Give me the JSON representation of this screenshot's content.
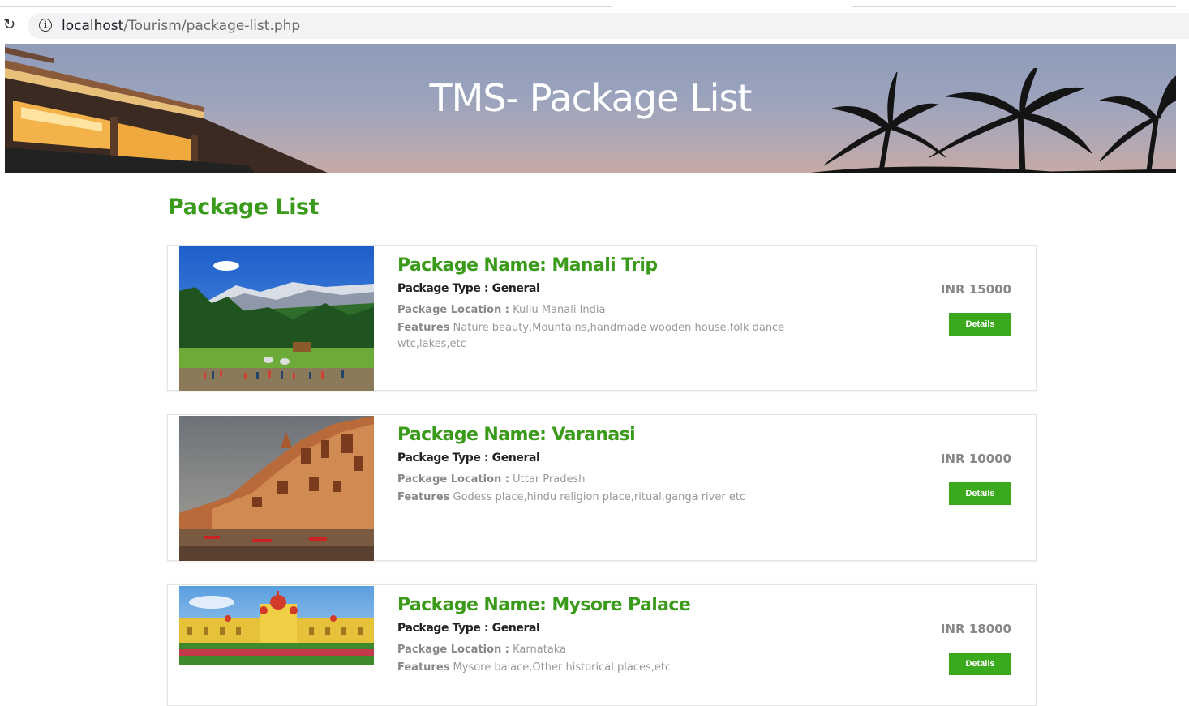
{
  "browser": {
    "url_host": "localhost",
    "url_path": "/Tourism/package-list.php"
  },
  "banner": {
    "title": "TMS- Package List"
  },
  "main": {
    "section_title": "Package List",
    "location_label": "Package Location :",
    "features_label": "Features",
    "details_label": "Details",
    "packages": [
      {
        "name": "Package Name: Manali Trip",
        "type": "Package Type : General",
        "location": "Kullu Manali India",
        "features": "Nature beauty,Mountains,handmade wooden house,folk dance wtc,lakes,etc",
        "price": "INR 15000"
      },
      {
        "name": "Package Name: Varanasi",
        "type": "Package Type : General",
        "location": "Uttar Pradesh",
        "features": "Godess place,hindu religion place,ritual,ganga river etc",
        "price": "INR 10000"
      },
      {
        "name": "Package Name: Mysore Palace",
        "type": "Package Type : General",
        "location": "Karnataka",
        "features": "Mysore balace,Other historical places,etc",
        "price": "INR 18000"
      }
    ]
  },
  "colors": {
    "accent_green": "#3a9a1a",
    "button_green": "#3aaa1c"
  }
}
